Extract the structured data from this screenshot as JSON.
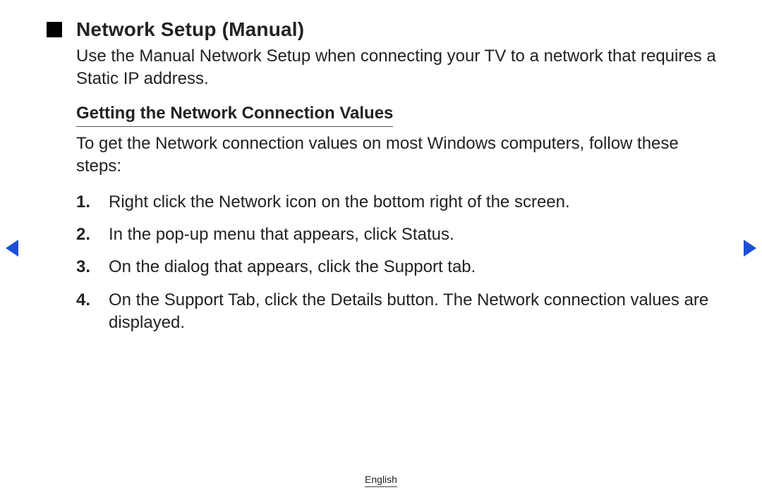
{
  "title": "Network Setup (Manual)",
  "intro": "Use the Manual Network Setup when connecting your TV to a network that requires a Static IP address.",
  "subheading": "Getting the Network Connection Values",
  "subintro": "To get the Network connection values on most Windows computers, follow these steps:",
  "steps": {
    "n1": "1.",
    "s1": "Right click the Network icon on the bottom right of the screen.",
    "n2": "2.",
    "s2": "In the pop-up menu that appears, click Status.",
    "n3": "3.",
    "s3": "On the dialog that appears, click the Support tab.",
    "n4": "4.",
    "s4": "On the Support Tab, click the Details button. The Network connection values are displayed."
  },
  "footer": {
    "language": "English"
  }
}
